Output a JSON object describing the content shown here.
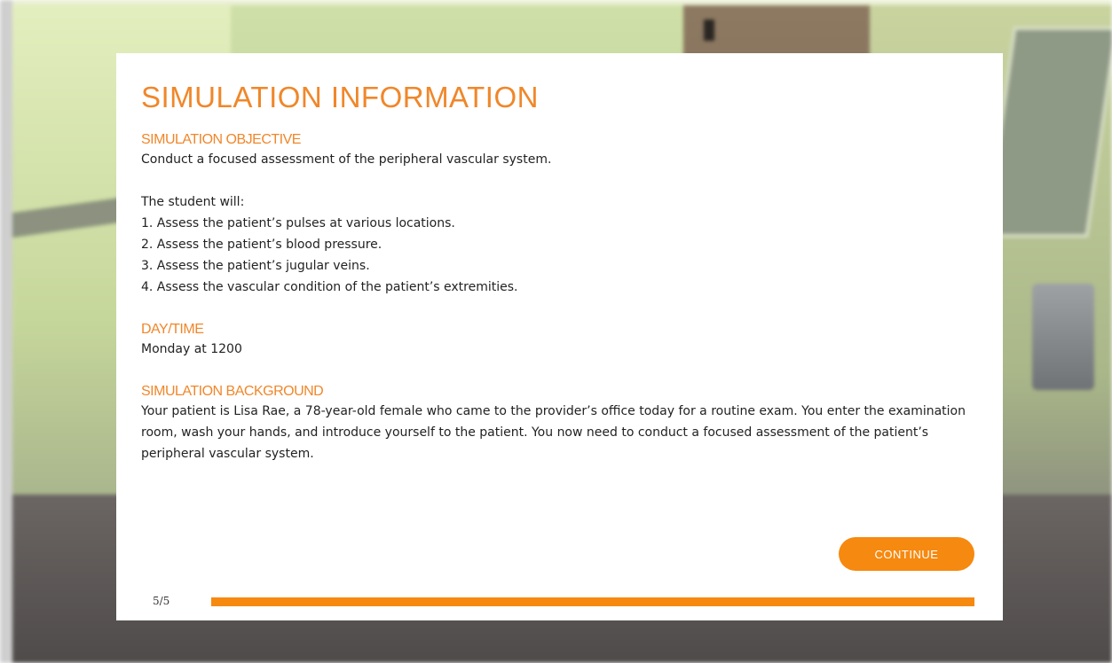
{
  "dialog": {
    "title": "SIMULATION INFORMATION",
    "objective": {
      "heading": "SIMULATION OBJECTIVE",
      "summary": "Conduct a focused assessment of the peripheral vascular system.",
      "intro": "The student will:",
      "items": [
        "1. Assess the patient’s pulses at various locations.",
        "2. Assess the patient’s blood pressure.",
        "3. Assess the patient’s jugular veins.",
        "4. Assess the vascular condition of the patient’s extremities."
      ]
    },
    "day_time": {
      "heading": "DAY/TIME",
      "value": "Monday at 1200"
    },
    "background": {
      "heading": "SIMULATION BACKGROUND",
      "text": "Your patient is Lisa Rae, a 78-year-old female who came to the provider’s office today for a routine exam. You enter the examination room, wash your hands, and introduce yourself to the patient. You now need to conduct a focused assessment of the patient’s peripheral vascular system."
    },
    "continue_label": "CONTINUE",
    "page_indicator": "5/5",
    "progress_fraction": 1.0
  },
  "colors": {
    "accent": "#f0872a",
    "button": "#f6890f",
    "text": "#222222"
  }
}
